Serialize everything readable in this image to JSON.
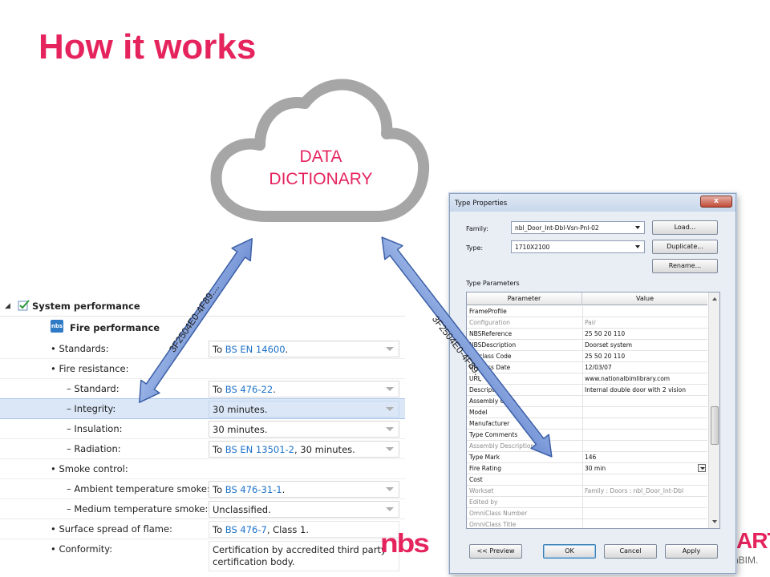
{
  "slide": {
    "title": "How it works"
  },
  "cloud": {
    "line1": "DATA",
    "line2": "DICTIONARY"
  },
  "arrows": {
    "left_label": "3F2504E0-4F89....",
    "right_label": "3F2504E0-4F89...."
  },
  "spec": {
    "section_title": "System performance",
    "badge": "nbs",
    "subsection_title": "Fire performance",
    "rows": [
      {
        "label": "• Standards:",
        "prefix": "To ",
        "link": "BS EN 14600",
        "suffix": "."
      },
      {
        "label": "• Fire resistance:"
      },
      {
        "label": "– Standard:",
        "prefix": "To ",
        "link": "BS 476-22",
        "suffix": "."
      },
      {
        "label": "– Integrity:",
        "value": "30 minutes."
      },
      {
        "label": "– Insulation:",
        "value": "30 minutes."
      },
      {
        "label": "– Radiation:",
        "prefix": "To ",
        "link": "BS EN 13501-2",
        "suffix": ", 30 minutes."
      },
      {
        "label": "• Smoke control:"
      },
      {
        "label": "– Ambient temperature smoke:",
        "prefix": "To ",
        "link": "BS 476-31-1",
        "suffix": "."
      },
      {
        "label": "– Medium temperature smoke:",
        "value": "Unclassified."
      },
      {
        "label": "• Surface spread of flame:",
        "prefix": "To ",
        "link": "BS 476-7",
        "suffix": ", Class 1."
      },
      {
        "label": "• Conformity:",
        "value": "Certification by accredited third party certification body."
      }
    ]
  },
  "logos": {
    "left": "nbs",
    "right_top": "ART.",
    "right_bottom": "nBIM."
  },
  "dialog": {
    "title": "Type Properties",
    "close": "x",
    "family_label": "Family:",
    "family_value": "nbl_Door_Int-Dbl-Vsn-Pnl-02",
    "type_label": "Type:",
    "type_value": "1710X2100",
    "load_button": "Load...",
    "duplicate_button": "Duplicate...",
    "rename_button": "Rename...",
    "type_parameters_label": "Type Parameters",
    "col_parameter": "Parameter",
    "col_value": "Value",
    "rows": [
      {
        "p": "FrameProfile",
        "v": ""
      },
      {
        "p": "Configuration",
        "v": "Pair",
        "dim": true
      },
      {
        "p": "NBSReference",
        "v": "25 50 20 110"
      },
      {
        "p": "NBSDescription",
        "v": "Doorset system"
      },
      {
        "p": "Uniclass Code",
        "v": "25 50 20 110"
      },
      {
        "p": "Uniclass Date",
        "v": "12/03/07"
      },
      {
        "p": "URL",
        "v": "www.nationalbimlibrary.com"
      },
      {
        "p": "Description",
        "v": "Internal double door with 2 vision"
      },
      {
        "p": "Assembly Code",
        "v": ""
      },
      {
        "p": "Model",
        "v": ""
      },
      {
        "p": "Manufacturer",
        "v": ""
      },
      {
        "p": "Type Comments",
        "v": ""
      },
      {
        "p": "Assembly Description",
        "v": "",
        "dim": true
      },
      {
        "p": "Type Mark",
        "v": "146"
      },
      {
        "p": "Fire Rating",
        "v": "30 min",
        "combo": true
      },
      {
        "p": "Cost",
        "v": ""
      },
      {
        "p": "Workset",
        "v": "Family  : Doors : nbl_Door_Int-Dbl",
        "dim": true
      },
      {
        "p": "Edited by",
        "v": "",
        "dim": true
      },
      {
        "p": "OmniClass Number",
        "v": "",
        "dim": true
      },
      {
        "p": "OmniClass Title",
        "v": "",
        "dim": true
      }
    ],
    "preview_button": "<< Preview",
    "ok_button": "OK",
    "cancel_button": "Cancel",
    "apply_button": "Apply"
  }
}
